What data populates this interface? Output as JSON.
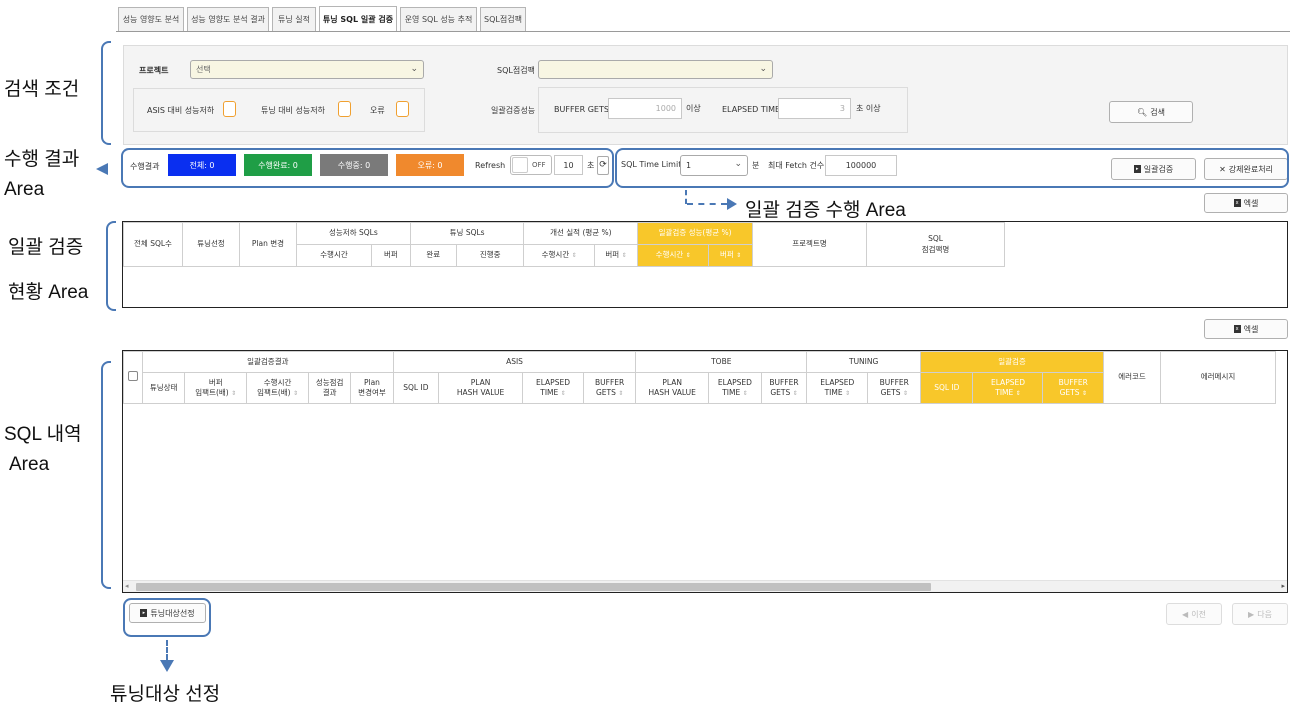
{
  "tabs": [
    "성능 영향도 분석",
    "성능 영향도 분석 결과",
    "튜닝 실적",
    "튜닝 SQL 일괄 검증",
    "운영 SQL 성능 추적",
    "SQL점검팩"
  ],
  "search": {
    "project_label": "프로젝트",
    "project_value": "선택",
    "sqlpack_label": "SQL점검팩",
    "sqlpack_value": "",
    "asis_label": "ASIS 대비 성능저하",
    "tuning_label": "튜닝 대비 성능저하",
    "error_label": "오류",
    "batch_perf_label": "일괄검증성능",
    "buffer_gets_label": "BUFFER GETS",
    "buffer_gets_value": "1000",
    "buffer_unit": "이상",
    "elapsed_label": "ELAPSED TIME",
    "elapsed_value": "3",
    "elapsed_unit": "초 이상",
    "search_button": "검색"
  },
  "result": {
    "label": "수행결과",
    "total": "전체: 0",
    "done": "수행완료: 0",
    "running": "수행중: 0",
    "error": "오류: 0",
    "refresh_label": "Refresh",
    "refresh_toggle": "OFF",
    "refresh_value": "10",
    "refresh_unit": "초"
  },
  "batch": {
    "time_limit_label": "SQL Time Limit",
    "time_limit_value": "1",
    "time_limit_unit": "분",
    "max_fetch_label": "최대 Fetch 건수",
    "max_fetch_value": "100000",
    "batch_button": "일괄검증",
    "force_button": "강제완료처리"
  },
  "excel_label": "엑셀",
  "summary_table": {
    "top": [
      "전체 SQL수",
      "튜닝선정",
      "Plan 변경",
      "성능저하 SQLs",
      "튜닝 SQLs",
      "개선 실적 (평균 %)",
      "일괄검증 성능(평균 %)",
      "프로젝트명",
      "SQL",
      "점검팩명"
    ],
    "sub": [
      "수행시간",
      "버퍼",
      "완료",
      "진행중",
      "수행시간",
      "버퍼",
      "수행시간",
      "버퍼"
    ]
  },
  "detail_table": {
    "groups": [
      "일괄검증결과",
      "ASIS",
      "TOBE",
      "TUNING",
      "일괄검증",
      "에러코드",
      "에러메시지"
    ],
    "sub": [
      "튜닝상태",
      "버퍼",
      "임팩트(배)",
      "수행시간",
      "임팩트(배)",
      "성능점검",
      "결과",
      "Plan",
      "변경여부",
      "SQL ID",
      "PLAN",
      "HASH VALUE",
      "ELAPSED",
      "TIME",
      "BUFFER",
      "GETS",
      "PLAN",
      "HASH VALUE",
      "ELAPSED",
      "TIME",
      "BUFFER",
      "GETS",
      "ELAPSED",
      "TIME",
      "BUFFER",
      "GETS",
      "SQL ID",
      "ELAPSED",
      "TIME",
      "BUFFER",
      "GETS"
    ]
  },
  "footer": {
    "tuning_select_button": "튜닝대상선정",
    "prev": "이전",
    "next": "다음"
  },
  "annotations": {
    "search_area": "검색 조건",
    "result_area_1": "수행 결과",
    "result_area_2": "Area",
    "batch_area": "일괄 검증 수행 Area",
    "status_area_1": "일괄 검증",
    "status_area_2": "현황 Area",
    "sql_area_1": "SQL 내역",
    "sql_area_2": "Area",
    "tuning_select": "튜닝대상 선정"
  },
  "colors": {
    "total": "#0a2ff0",
    "done": "#1f9e46",
    "running": "#7a7a7a",
    "error": "#f0892d",
    "highlight": "#f8c72a",
    "callout": "#4a78b5"
  }
}
